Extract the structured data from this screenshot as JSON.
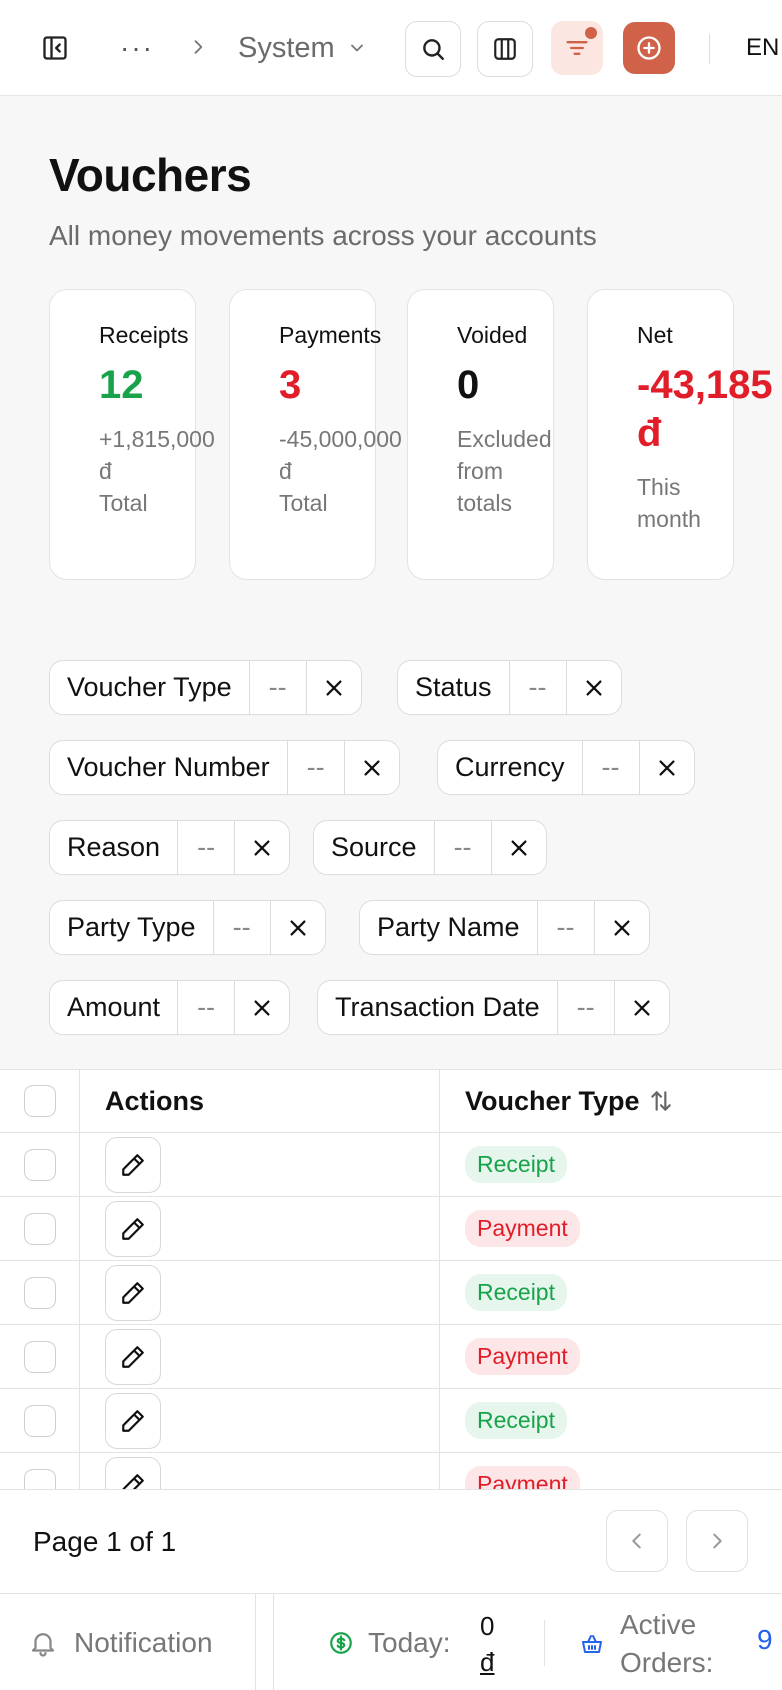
{
  "topbar": {
    "breadcrumb_more": "···",
    "breadcrumb_current": "System",
    "language": "EN",
    "accent_color": "#d0624a"
  },
  "page": {
    "title": "Vouchers",
    "subtitle": "All money movements across your accounts"
  },
  "stats": [
    {
      "label": "Receipts",
      "value": "12",
      "sub1": "+1,815,000",
      "sub2": "đ",
      "sub3": "Total",
      "color": "#18a34a"
    },
    {
      "label": "Payments",
      "value": "3",
      "sub1": "-45,000,000",
      "sub2": "đ",
      "sub3": "Total",
      "color": "#e11d2a"
    },
    {
      "label": "Voided",
      "value": "0",
      "sub1": "Excluded",
      "sub2": "from",
      "sub3": "totals",
      "color": "#111111"
    },
    {
      "label": "Net",
      "value": "-43,185",
      "value2": "đ",
      "sub1": "This",
      "sub2": "month",
      "color": "#e11d2a"
    }
  ],
  "filters": [
    {
      "label": "Voucher Type",
      "value": "--"
    },
    {
      "label": "Status",
      "value": "--"
    },
    {
      "label": "Voucher Number",
      "value": "--"
    },
    {
      "label": "Currency",
      "value": "--"
    },
    {
      "label": "Reason",
      "value": "--"
    },
    {
      "label": "Source",
      "value": "--"
    },
    {
      "label": "Party Type",
      "value": "--"
    },
    {
      "label": "Party Name",
      "value": "--"
    },
    {
      "label": "Amount",
      "value": "--"
    },
    {
      "label": "Transaction Date",
      "value": "--"
    }
  ],
  "table": {
    "headers": {
      "actions": "Actions",
      "voucher_type": "Voucher Type"
    },
    "rows": [
      {
        "type": "Receipt"
      },
      {
        "type": "Payment"
      },
      {
        "type": "Receipt"
      },
      {
        "type": "Payment"
      },
      {
        "type": "Receipt"
      },
      {
        "type": "Payment"
      }
    ]
  },
  "pagination": {
    "text": "Page 1 of 1"
  },
  "footer": {
    "notification": "Notification",
    "today_label": "Today:",
    "today_value": "0",
    "today_currency": "đ",
    "orders_label_1": "Active",
    "orders_label_2": "Orders:",
    "orders_value": "9"
  }
}
